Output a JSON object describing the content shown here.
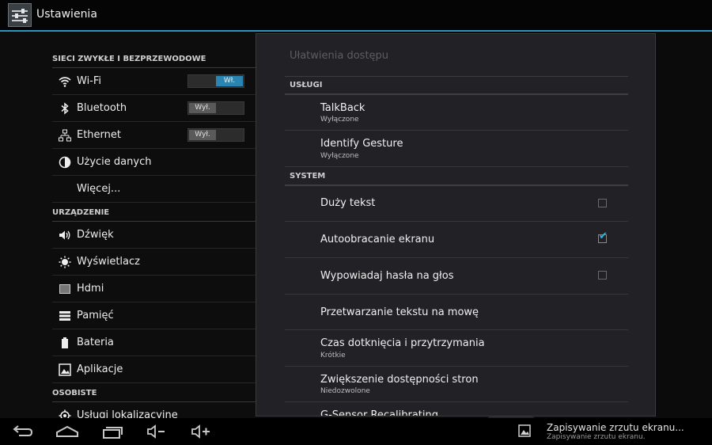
{
  "app": {
    "title": "Ustawienia"
  },
  "left": {
    "sections": [
      {
        "header": "SIECI ZWYKŁE I BEZPRZEWODOWE"
      },
      {
        "header": "URZĄDZENIE"
      },
      {
        "header": "OSOBISTE"
      }
    ],
    "items": [
      {
        "label": "Wi-Fi",
        "icon": "wifi-icon",
        "toggle": "Wł."
      },
      {
        "label": "Bluetooth",
        "icon": "bluetooth-icon",
        "toggle": "Wył."
      },
      {
        "label": "Ethernet",
        "icon": "ethernet-icon",
        "toggle": "Wył."
      },
      {
        "label": "Użycie danych",
        "icon": "data-usage-icon"
      },
      {
        "label": "Więcej..."
      },
      {
        "label": "Dźwięk",
        "icon": "sound-icon"
      },
      {
        "label": "Wyświetlacz",
        "icon": "display-icon"
      },
      {
        "label": "Hdmi",
        "icon": "hdmi-icon"
      },
      {
        "label": "Pamięć",
        "icon": "storage-icon"
      },
      {
        "label": "Bateria",
        "icon": "battery-icon"
      },
      {
        "label": "Aplikacje",
        "icon": "apps-icon"
      },
      {
        "label": "Usługi lokalizacyjne",
        "icon": "location-icon"
      }
    ]
  },
  "panel": {
    "title": "Ułatwienia dostępu",
    "sections": [
      {
        "label": "USŁUGI"
      },
      {
        "label": "SYSTEM"
      }
    ],
    "rows": [
      {
        "title": "TalkBack",
        "sub": "Wyłączone"
      },
      {
        "title": "Identify Gesture",
        "sub": "Wyłączone"
      },
      {
        "title": "Duży tekst",
        "checked": false
      },
      {
        "title": "Autoobracanie ekranu",
        "checked": true
      },
      {
        "title": "Wypowiadaj hasła na głos",
        "checked": false
      },
      {
        "title": "Przetwarzanie tekstu na mowę"
      },
      {
        "title": "Czas dotknięcia i przytrzymania",
        "sub": "Krótkie"
      },
      {
        "title": "Zwiększenie dostępności stron",
        "sub": "Niedozwolone"
      },
      {
        "title": "G-Sensor Recalibrating"
      }
    ]
  },
  "systembar": {
    "buttons": [
      "back-icon",
      "home-icon",
      "recent-apps-icon",
      "volume-down-icon",
      "volume-up-icon"
    ],
    "notification": {
      "title": "Zapisywanie zrzutu ekranu...",
      "sub": "Zapisywanie zrzutu ekranu."
    }
  },
  "colors": {
    "accent": "#2d95bd",
    "check": "#33b5e5"
  }
}
